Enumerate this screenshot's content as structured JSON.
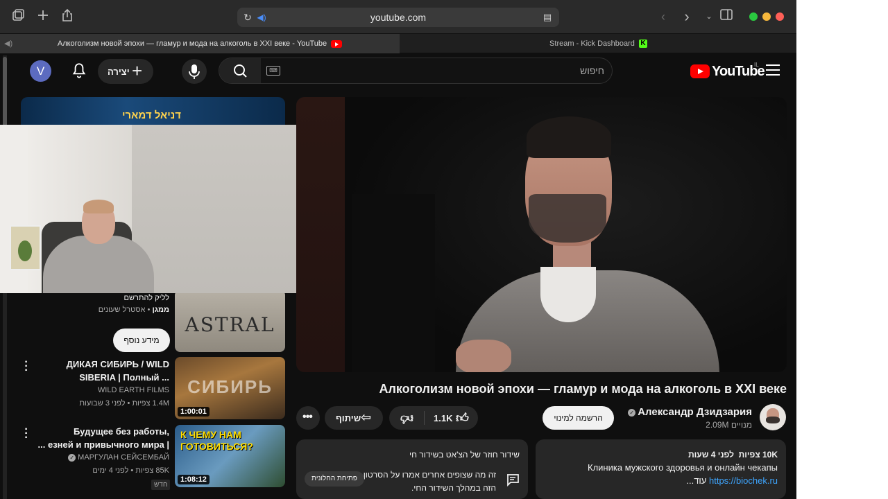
{
  "browser": {
    "address": "youtube.com",
    "tabs": [
      {
        "title": "Алкоголизм новой эпохи — гламур и мода на алкоголь в XXI веке - YouTube",
        "active": true
      },
      {
        "title": "Stream - Kick Dashboard",
        "active": false
      }
    ],
    "traffic_colors": [
      "#2ac940",
      "#f6b73c",
      "#fe5f57"
    ]
  },
  "header": {
    "avatar_letter": "V",
    "create_label": "יצירה",
    "search_placeholder": "חיפוש",
    "logo_text": "YouTube",
    "logo_region": "IL"
  },
  "sidebar": {
    "banner_text": "דניאל דמארי",
    "current": {
      "title_tail": "לליק להתרשם",
      "channel": "ממגן",
      "channel_tag": "אסטרל שעונים",
      "thumb_text": "ASTRAL",
      "info_button": "מידע נוסף"
    },
    "items": [
      {
        "title_line1": "ДИКАЯ СИБИРЬ / WILD",
        "title_line2": "SIBERIA | Полный ...",
        "channel": "WILD EARTH FILMS",
        "views": "1.4M צפיות",
        "age": "לפני 3 שבועות",
        "duration": "1:00:01",
        "thumb_text": "СИБИРЬ"
      },
      {
        "title_line1": "Будущее без работы,",
        "title_line2": "... езней и привычного мира |",
        "channel": "МАРГУЛАН СЕЙСЕМБАЙ",
        "views": "85K צפיות",
        "age": "לפני 4 ימים",
        "duration": "1:08:12",
        "badge": "חדש",
        "thumb_text": "К ЧЕМУ НАМ ГОТОВИТЬСЯ?"
      }
    ]
  },
  "video": {
    "title": "Алкоголизм новой эпохи — гламур и мода на алкоголь в XXI веке",
    "channel_name": "Александр Дзидзария",
    "subscribers": "2.09M מנויים",
    "subscribe_label": "הרשמה למינוי",
    "likes": "1.1K",
    "share_label": "שיתוף",
    "more_label": "•••"
  },
  "chat": {
    "title": "שידור חוזר של הצ'אט בשידור חי",
    "body": "זה מה שצופים אחרים אמרו על הסרטון הזה במהלך השידור החי.",
    "button": "פתיחת החלונית"
  },
  "description": {
    "views": "10K צפיות",
    "age": "לפני 4 שעות",
    "line2": "Клиника мужского здоровья  и онлайн чекапы",
    "link": "https://biochek.ru",
    "more": "...עוד"
  }
}
